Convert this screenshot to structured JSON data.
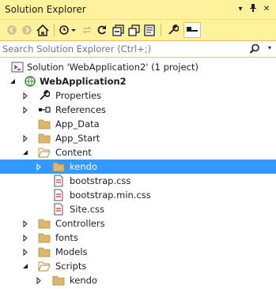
{
  "window": {
    "title": "Solution Explorer",
    "dropdown_glyph": "▾",
    "pin_glyph": "⊥",
    "close_glyph": "✕"
  },
  "search": {
    "placeholder": "Search Solution Explorer (Ctrl+;)",
    "dropdown_glyph": "▾"
  },
  "colors": {
    "chrome": "#fff29d",
    "selection": "#3399ff",
    "folder": "#dcb66b"
  },
  "tree": {
    "solution": {
      "label": "Solution 'WebApplication2' (1 project)",
      "icon": "solution-icon"
    },
    "project": {
      "label": "WebApplication2",
      "icon": "web-project-icon"
    },
    "items": [
      {
        "label": "Properties",
        "icon": "wrench-icon"
      },
      {
        "label": "References",
        "icon": "references-icon"
      },
      {
        "label": "App_Data",
        "icon": "folder-icon"
      },
      {
        "label": "App_Start",
        "icon": "folder-icon"
      },
      {
        "label": "Content",
        "icon": "folder-open-icon"
      },
      {
        "label": "kendo",
        "icon": "folder-icon"
      },
      {
        "label": "bootstrap.css",
        "icon": "css-file-icon"
      },
      {
        "label": "bootstrap.min.css",
        "icon": "css-file-icon"
      },
      {
        "label": "Site.css",
        "icon": "css-file-icon"
      },
      {
        "label": "Controllers",
        "icon": "folder-icon"
      },
      {
        "label": "fonts",
        "icon": "folder-icon"
      },
      {
        "label": "Models",
        "icon": "folder-icon"
      },
      {
        "label": "Scripts",
        "icon": "folder-open-icon"
      },
      {
        "label": "kendo",
        "icon": "folder-icon"
      }
    ]
  }
}
